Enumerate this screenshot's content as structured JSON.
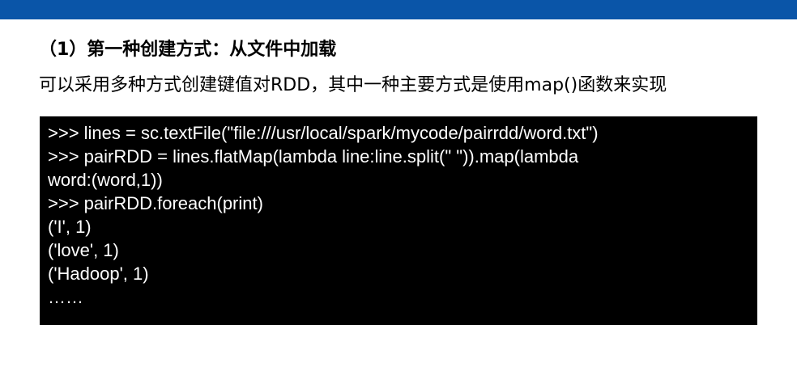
{
  "slide": {
    "title": "（1）第一种创建方式：从文件中加载",
    "description": "可以采用多种方式创建键值对RDD，其中一种主要方式是使用map()函数来实现",
    "code_lines": [
      ">>> lines = sc.textFile(\"file:///usr/local/spark/mycode/pairrdd/word.txt\")",
      ">>> pairRDD = lines.flatMap(lambda line:line.split(\" \")).map(lambda",
      "word:(word,1))",
      ">>> pairRDD.foreach(print)",
      "('I', 1)",
      "('love', 1)",
      "('Hadoop', 1)",
      "……"
    ]
  },
  "colors": {
    "top_bar": "#0a55a8",
    "code_background": "#000000",
    "code_text": "#ffffff"
  }
}
